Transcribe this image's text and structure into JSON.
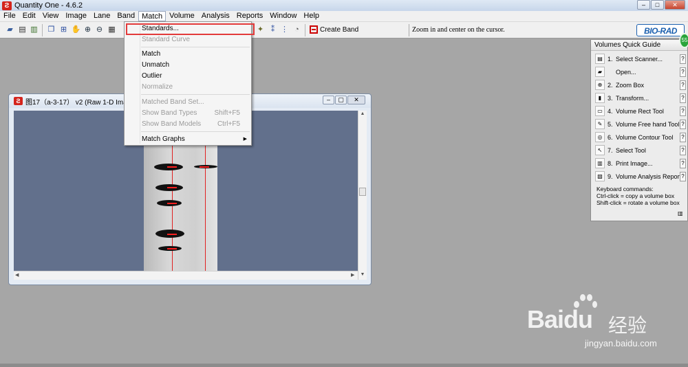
{
  "app": {
    "title": "Quantity One - 4.6.2"
  },
  "menubar": {
    "items": [
      "File",
      "Edit",
      "View",
      "Image",
      "Lane",
      "Band",
      "Match",
      "Volume",
      "Analysis",
      "Reports",
      "Window",
      "Help"
    ]
  },
  "toolbar": {
    "create_band": "Create Band",
    "status_text": "Zoom in and center on the cursor.",
    "logo_text": "BIO-RAD"
  },
  "match_menu": {
    "items": [
      {
        "label": "Standards...",
        "enabled": true
      },
      {
        "label": "Standard Curve",
        "enabled": false
      },
      {
        "label": "Match",
        "enabled": true
      },
      {
        "label": "Unmatch",
        "enabled": true
      },
      {
        "label": "Outlier",
        "enabled": true
      },
      {
        "label": "Normalize",
        "enabled": false
      },
      {
        "label": "Matched Band Set...",
        "enabled": false
      },
      {
        "label": "Show Band Types",
        "shortcut": "Shift+F5",
        "enabled": false
      },
      {
        "label": "Show Band Models",
        "shortcut": "Ctrl+F5",
        "enabled": false
      },
      {
        "label": "Match Graphs",
        "enabled": true,
        "submenu": true
      }
    ]
  },
  "image_window": {
    "title": "图17（a-3-17） v2 (Raw 1-D Image"
  },
  "quick_guide": {
    "title": "Volumes Quick Guide",
    "badge": "55",
    "items": [
      {
        "num": "1.",
        "label": "Select Scanner...",
        "icon": "scanner-icon"
      },
      {
        "num": "",
        "label": "Open...",
        "icon": "open-folder-icon"
      },
      {
        "num": "2.",
        "label": "Zoom Box",
        "icon": "zoom-icon"
      },
      {
        "num": "3.",
        "label": "Transform...",
        "icon": "transform-icon"
      },
      {
        "num": "4.",
        "label": "Volume Rect Tool",
        "icon": "rect-tool-icon"
      },
      {
        "num": "5.",
        "label": "Volume Free hand Tool",
        "icon": "freehand-icon"
      },
      {
        "num": "6.",
        "label": "Volume Contour Tool",
        "icon": "contour-icon"
      },
      {
        "num": "7.",
        "label": "Select Tool",
        "icon": "arrow-icon"
      },
      {
        "num": "8.",
        "label": "Print Image...",
        "icon": "printer-icon"
      },
      {
        "num": "9.",
        "label": "Volume Analysis Report...",
        "icon": "report-icon"
      }
    ],
    "help_glyph": "?",
    "keys": [
      "Keyboard commands:",
      "Ctrl-click = copy a volume box",
      "Shift-click = rotate a volume box"
    ]
  },
  "watermark": {
    "brand": "Baidu",
    "cn": "经验",
    "url": "jingyan.baidu.com"
  },
  "colors": {
    "workspace": "#a6a6a6",
    "canvas": "#62708c",
    "highlight": "#e33a3a",
    "lane": "#e02020"
  }
}
